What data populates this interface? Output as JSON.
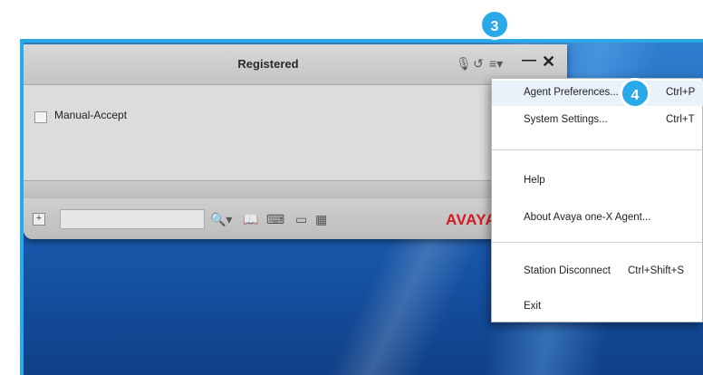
{
  "window": {
    "title": "Registered",
    "titlebar_icons": [
      "microphone-icon",
      "callback-icon",
      "menu-list-icon",
      "minimize-icon",
      "close-icon"
    ]
  },
  "content": {
    "checkbox_label": "Manual-Accept",
    "checkbox_checked": false
  },
  "bottombar": {
    "search_value": "",
    "icons": [
      "search-icon",
      "book-icon",
      "dialpad-icon",
      "window-icon",
      "calendar-icon"
    ],
    "logo": "AVAYA"
  },
  "menu": {
    "items": [
      {
        "label": "Agent Preferences...",
        "shortcut": "Ctrl+P"
      },
      {
        "label": "System Settings...",
        "shortcut": "Ctrl+T"
      },
      {
        "label": "Help",
        "shortcut": ""
      },
      {
        "label": "About Avaya one-X Agent...",
        "shortcut": ""
      },
      {
        "label": "Station Disconnect",
        "shortcut": "Ctrl+Shift+S"
      },
      {
        "label": "Exit",
        "shortcut": ""
      }
    ]
  },
  "callouts": {
    "step_menu": "3",
    "step_preferences": "4"
  },
  "colors": {
    "callout": "#29a9e8",
    "avaya_red": "#d71921",
    "desktop_blue": "#1f64b8"
  }
}
